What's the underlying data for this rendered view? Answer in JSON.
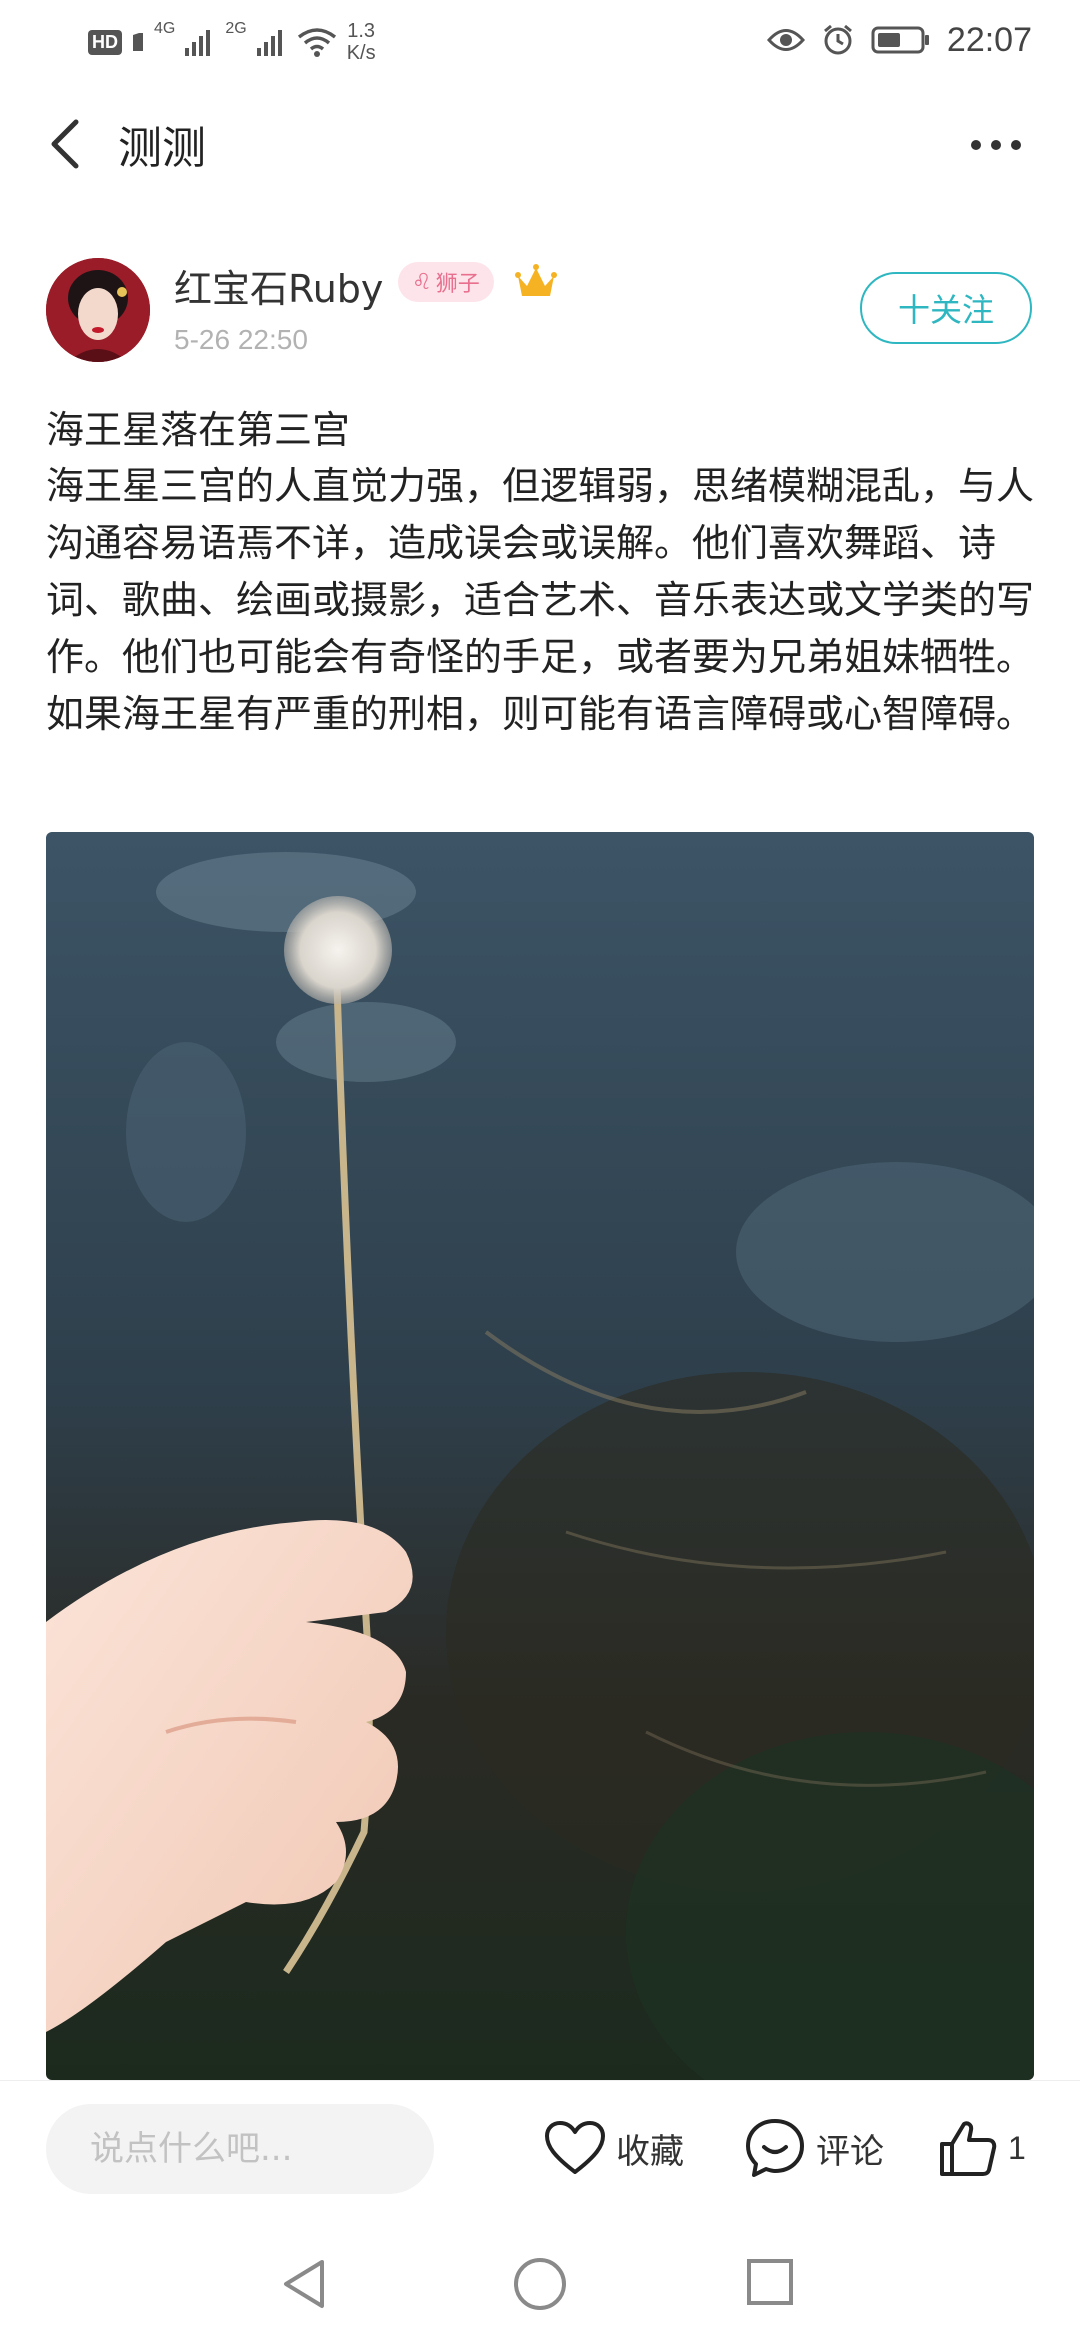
{
  "status_bar": {
    "hd_label": "HD",
    "sim1_label": "4G",
    "sim2_label": "2G",
    "net_speed_value": "1.3",
    "net_speed_unit": "K/s",
    "time": "22:07",
    "icons": [
      "eye-icon",
      "alarm-icon",
      "battery-icon",
      "wifi-icon",
      "signal-icon"
    ]
  },
  "header": {
    "title": "测测",
    "back_icon": "chevron-left-icon",
    "more_icon": "more-dots-icon"
  },
  "author": {
    "name": "红宝石Ruby",
    "zodiac_symbol": "♌",
    "zodiac_label": "狮子",
    "post_time": "5-26 22:50",
    "follow_label": "十关注",
    "vip_icon": "crown-icon"
  },
  "post": {
    "title": "海王星落在第三宫",
    "body": "海王星三宫的人直觉力强，但逻辑弱，思绪模糊混乱，与人沟通容易语焉不详，造成误会或误解。他们喜欢舞蹈、诗词、歌曲、绘画或摄影，适合艺术、音乐表达或文学类的写作。他们也可能会有奇怪的手足，或者要为兄弟姐妹牺牲。如果海王星有严重的刑相，则可能有语言障碍或心智障碍。",
    "image_subject": "dandelion-photo"
  },
  "actions": {
    "comment_placeholder": "说点什么吧...",
    "favorite_label": "收藏",
    "comment_label": "评论",
    "like_count": "1"
  },
  "colors": {
    "accent": "#2fb7c1",
    "zodiac_bg": "#fde4ea",
    "zodiac_text": "#e8708e",
    "crown": "#f5b324"
  }
}
